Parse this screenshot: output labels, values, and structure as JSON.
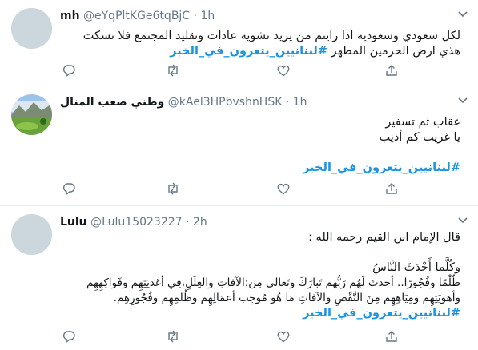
{
  "tweets": [
    {
      "name": "mh",
      "handle": "@eYqPltKGe6tqBjC",
      "sep": "·",
      "time": "1h",
      "lines": [
        "لكل سعودي وسعوديه اذا رايتم من يريد تشويه عادات وتقليد المجتمع فلا تسكت",
        "هذي ارض الحرمين المطهر"
      ],
      "hashtag": "#لبنانيين_يتعرون_في_الخبر"
    },
    {
      "name": "وطني صعب المنال",
      "handle": "@kAel3HPbvshnHSK",
      "sep": "·",
      "time": "1h",
      "lines": [
        "عقاب ثم تسفير",
        "يا غريب كم أديب"
      ],
      "hashtag": "#لبنانيين_يتعرون_في_الخبر"
    },
    {
      "name": "Lulu",
      "handle": "@Lulu15023227",
      "sep": "·",
      "time": "2h",
      "lines": [
        "قال الإمام ابن القيم رحمه الله :",
        "وكُلَّما أَحْدَثَ النَّاسُ",
        "ظُلْمًا وفُجُورًا.. أحدث لَهُم رَبُّهم تَبارَكَ وتَعالى مِن:الآفاتِ والعِلَلِ،فِي أغذيَتِهِم وفَواكِهِهِم",
        "وأهويَتِهِم ومِيَاهِهِم مِنَ النَّقْصِ والآفاتِ مَا هُو مُوجِب أعمَالِهِم وظُلمِهِم وفُجُورِهِم."
      ],
      "hashtag": "#لبنانيين_يتعرون_في_الخبر"
    }
  ],
  "colors": {
    "link": "#1b95e0",
    "icon": "#657786",
    "divider": "#e6ecf0"
  },
  "icons": [
    "reply-icon",
    "retweet-icon",
    "like-icon",
    "share-icon",
    "chevron-down-icon"
  ]
}
